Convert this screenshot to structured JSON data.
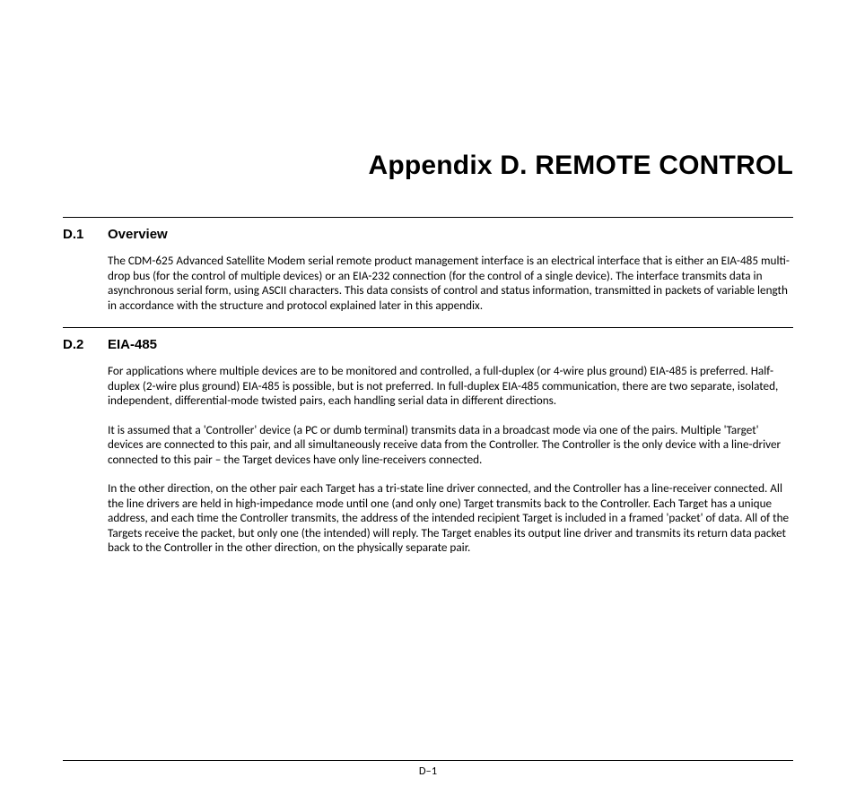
{
  "title": "Appendix D.  REMOTE CONTROL",
  "sections": [
    {
      "num": "D.1",
      "title": "Overview",
      "paragraphs": [
        "The CDM-625 Advanced Satellite Modem serial remote product management interface is an electrical interface that is either an EIA-485 multi-drop bus (for the control of multiple devices) or an EIA-232 connection (for the control of a single device). The interface transmits data in asynchronous serial form, using ASCII characters. This data consists of control and status information, transmitted in packets of variable length in accordance with the structure and protocol explained later in this appendix."
      ]
    },
    {
      "num": "D.2",
      "title": "EIA-485",
      "paragraphs": [
        "For applications where multiple devices are to be monitored and controlled, a full-duplex (or 4-wire plus ground) EIA-485 is preferred. Half-duplex (2-wire plus ground) EIA-485 is possible, but is not preferred. In full-duplex EIA-485 communication, there are two separate, isolated, independent, differential-mode twisted pairs, each handling serial data in different directions.",
        "It is assumed that a 'Controller' device (a PC or dumb terminal) transmits data in a broadcast mode via one of the pairs. Multiple 'Target' devices are connected to this pair, and all simultaneously receive data from the Controller. The Controller is the only device with a line-driver connected to this pair – the Target devices have only line-receivers connected.",
        "In the other direction, on the other pair each Target has a tri-state line driver connected, and the Controller has a line-receiver connected. All the line drivers are held in high-impedance mode until one (and only one) Target transmits back to the Controller. Each Target has a unique address, and each time the Controller transmits, the address of the intended recipient Target is included in a framed 'packet' of data. All of the Targets receive the packet, but only one (the intended) will reply. The Target enables its output line driver and transmits its return data packet back to the Controller in the other direction, on the physically separate pair."
      ]
    }
  ],
  "page_number": "D–1"
}
